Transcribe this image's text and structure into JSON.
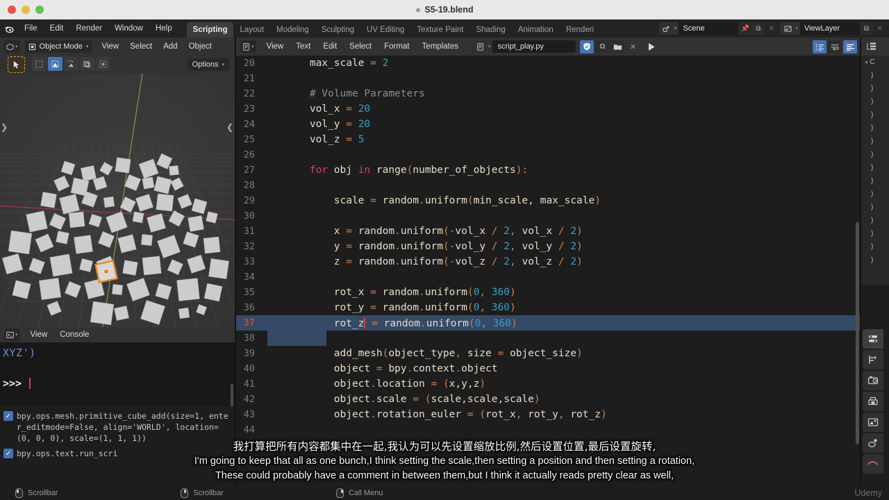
{
  "window": {
    "title": "S5-19.blend",
    "traffic_lights": [
      "close",
      "minimize",
      "maximize"
    ]
  },
  "topbar": {
    "logo_icon": "blender-logo-icon",
    "menus": [
      "File",
      "Edit",
      "Render",
      "Window",
      "Help"
    ],
    "workspace_tabs": [
      {
        "label": "Scripting",
        "active": true
      },
      {
        "label": "Layout",
        "active": false
      },
      {
        "label": "Modeling",
        "active": false
      },
      {
        "label": "Sculpting",
        "active": false
      },
      {
        "label": "UV Editing",
        "active": false
      },
      {
        "label": "Texture Paint",
        "active": false
      },
      {
        "label": "Shading",
        "active": false
      },
      {
        "label": "Animation",
        "active": false
      },
      {
        "label": "Renderi",
        "active": false
      }
    ],
    "scene": {
      "icon": "scene-icon",
      "name": "Scene",
      "pin_icon": "pin-icon",
      "copy_icon": "duplicate-icon",
      "close_icon": "x-icon"
    },
    "viewlayer": {
      "icon": "viewlayer-icon",
      "name": "ViewLayer",
      "copy_icon": "duplicate-icon",
      "close_icon": "x-icon"
    }
  },
  "viewport": {
    "editor_type_icon": "editor-type-3dview-icon",
    "mode": "Object Mode",
    "mode_icon": "object-mode-icon",
    "menus": [
      "View",
      "Select",
      "Add",
      "Object"
    ],
    "tool_icon": "tweak-cursor-icon",
    "select_modes": [
      "select-box-icon",
      "select-circle-icon",
      "select-lasso-icon",
      "select-extend-icon",
      "select-invert-icon"
    ],
    "options_label": "Options",
    "gizmo_axes": [
      "X",
      "Y",
      "Z"
    ],
    "object_count_visible": 110,
    "arrow_left_icon": "chevron-left-icon",
    "arrow_right_icon": "chevron-left-icon"
  },
  "console": {
    "editor_type_icon": "editor-type-console-icon",
    "menus": [
      "View",
      "Console"
    ],
    "last_output": "XYZ')",
    "prompt": ">>>",
    "input_value": ""
  },
  "info_log": {
    "rows": [
      {
        "checked": true,
        "text": "bpy.ops.mesh.primitive_cube_add(size=1, enter_editmode=False, align='WORLD', location=(0, 0, 0), scale=(1, 1, 1))"
      },
      {
        "checked": true,
        "text": "bpy.ops.text.run_scri"
      }
    ]
  },
  "editor": {
    "editor_type_icon": "editor-type-text-icon",
    "menus": [
      "View",
      "Text",
      "Edit",
      "Select",
      "Format",
      "Templates"
    ],
    "datablock_icon": "text-datablock-icon",
    "filename": "script_play.py",
    "buttons": [
      {
        "name": "register-toggle",
        "icon": "shield-check-icon",
        "on": true
      },
      {
        "name": "new-text-button",
        "icon": "duplicate-icon",
        "on": false
      },
      {
        "name": "open-text-button",
        "icon": "folder-icon",
        "on": false
      },
      {
        "name": "unlink-text-button",
        "icon": "x-icon",
        "on": false
      },
      {
        "name": "run-script-button",
        "icon": "play-icon",
        "on": false
      }
    ],
    "toggles": [
      {
        "name": "line-numbers-toggle",
        "icon": "line-numbers-icon",
        "on": true
      },
      {
        "name": "word-wrap-toggle",
        "icon": "word-wrap-icon",
        "on": false
      },
      {
        "name": "syntax-highlight-toggle",
        "icon": "syntax-highlight-icon",
        "on": true
      }
    ],
    "cursor_line": 37,
    "selection_lines": [
      37,
      38
    ],
    "code": [
      {
        "n": 20,
        "tokens": [
          {
            "t": "        ",
            "c": "plain"
          },
          {
            "t": "max_scale ",
            "c": "plain"
          },
          {
            "t": "= ",
            "c": "op"
          },
          {
            "t": "2",
            "c": "num"
          }
        ]
      },
      {
        "n": 21,
        "tokens": []
      },
      {
        "n": 22,
        "tokens": [
          {
            "t": "        ",
            "c": "plain"
          },
          {
            "t": "# Volume Parameters",
            "c": "com"
          }
        ]
      },
      {
        "n": 23,
        "tokens": [
          {
            "t": "        ",
            "c": "plain"
          },
          {
            "t": "vol_x ",
            "c": "plain"
          },
          {
            "t": "= ",
            "c": "op"
          },
          {
            "t": "20",
            "c": "num"
          }
        ]
      },
      {
        "n": 24,
        "tokens": [
          {
            "t": "        ",
            "c": "plain"
          },
          {
            "t": "vol_y ",
            "c": "plain"
          },
          {
            "t": "= ",
            "c": "op"
          },
          {
            "t": "20",
            "c": "num"
          }
        ]
      },
      {
        "n": 25,
        "tokens": [
          {
            "t": "        ",
            "c": "plain"
          },
          {
            "t": "vol_z ",
            "c": "plain"
          },
          {
            "t": "= ",
            "c": "op"
          },
          {
            "t": "5",
            "c": "num"
          }
        ]
      },
      {
        "n": 26,
        "tokens": []
      },
      {
        "n": 27,
        "tokens": [
          {
            "t": "        ",
            "c": "plain"
          },
          {
            "t": "for",
            "c": "kw"
          },
          {
            "t": " obj ",
            "c": "plain"
          },
          {
            "t": "in",
            "c": "kw"
          },
          {
            "t": " range",
            "c": "plain"
          },
          {
            "t": "(",
            "c": "op"
          },
          {
            "t": "number_of_objects",
            "c": "plain"
          },
          {
            "t": "):",
            "c": "op"
          }
        ]
      },
      {
        "n": 28,
        "tokens": []
      },
      {
        "n": 29,
        "tokens": [
          {
            "t": "            ",
            "c": "plain"
          },
          {
            "t": "scale ",
            "c": "plain"
          },
          {
            "t": "= ",
            "c": "op"
          },
          {
            "t": "random",
            "c": "plain"
          },
          {
            "t": ".",
            "c": "op"
          },
          {
            "t": "uniform",
            "c": "plain"
          },
          {
            "t": "(",
            "c": "op"
          },
          {
            "t": "min_scale, max_scale",
            "c": "plain"
          },
          {
            "t": ")",
            "c": "op"
          }
        ]
      },
      {
        "n": 30,
        "tokens": []
      },
      {
        "n": 31,
        "tokens": [
          {
            "t": "            ",
            "c": "plain"
          },
          {
            "t": "x ",
            "c": "plain"
          },
          {
            "t": "= ",
            "c": "op"
          },
          {
            "t": "random",
            "c": "plain"
          },
          {
            "t": ".",
            "c": "op"
          },
          {
            "t": "uniform",
            "c": "plain"
          },
          {
            "t": "(-",
            "c": "op"
          },
          {
            "t": "vol_x ",
            "c": "plain"
          },
          {
            "t": "/ ",
            "c": "op"
          },
          {
            "t": "2",
            "c": "num"
          },
          {
            "t": ", ",
            "c": "op"
          },
          {
            "t": "vol_x ",
            "c": "plain"
          },
          {
            "t": "/ ",
            "c": "op"
          },
          {
            "t": "2",
            "c": "num"
          },
          {
            "t": ")",
            "c": "op"
          }
        ]
      },
      {
        "n": 32,
        "tokens": [
          {
            "t": "            ",
            "c": "plain"
          },
          {
            "t": "y ",
            "c": "plain"
          },
          {
            "t": "= ",
            "c": "op"
          },
          {
            "t": "random",
            "c": "plain"
          },
          {
            "t": ".",
            "c": "op"
          },
          {
            "t": "uniform",
            "c": "plain"
          },
          {
            "t": "(-",
            "c": "op"
          },
          {
            "t": "vol_y ",
            "c": "plain"
          },
          {
            "t": "/ ",
            "c": "op"
          },
          {
            "t": "2",
            "c": "num"
          },
          {
            "t": ", ",
            "c": "op"
          },
          {
            "t": "vol_y ",
            "c": "plain"
          },
          {
            "t": "/ ",
            "c": "op"
          },
          {
            "t": "2",
            "c": "num"
          },
          {
            "t": ")",
            "c": "op"
          }
        ]
      },
      {
        "n": 33,
        "tokens": [
          {
            "t": "            ",
            "c": "plain"
          },
          {
            "t": "z ",
            "c": "plain"
          },
          {
            "t": "= ",
            "c": "op"
          },
          {
            "t": "random",
            "c": "plain"
          },
          {
            "t": ".",
            "c": "op"
          },
          {
            "t": "uniform",
            "c": "plain"
          },
          {
            "t": "(-",
            "c": "op"
          },
          {
            "t": "vol_z ",
            "c": "plain"
          },
          {
            "t": "/ ",
            "c": "op"
          },
          {
            "t": "2",
            "c": "num"
          },
          {
            "t": ", ",
            "c": "op"
          },
          {
            "t": "vol_z ",
            "c": "plain"
          },
          {
            "t": "/ ",
            "c": "op"
          },
          {
            "t": "2",
            "c": "num"
          },
          {
            "t": ")",
            "c": "op"
          }
        ]
      },
      {
        "n": 34,
        "tokens": []
      },
      {
        "n": 35,
        "tokens": [
          {
            "t": "            ",
            "c": "plain"
          },
          {
            "t": "rot_x ",
            "c": "plain"
          },
          {
            "t": "= ",
            "c": "op"
          },
          {
            "t": "random",
            "c": "plain"
          },
          {
            "t": ".",
            "c": "op"
          },
          {
            "t": "uniform",
            "c": "plain"
          },
          {
            "t": "(",
            "c": "op"
          },
          {
            "t": "0",
            "c": "num"
          },
          {
            "t": ", ",
            "c": "op"
          },
          {
            "t": "360",
            "c": "num"
          },
          {
            "t": ")",
            "c": "op"
          }
        ]
      },
      {
        "n": 36,
        "tokens": [
          {
            "t": "            ",
            "c": "plain"
          },
          {
            "t": "rot_y ",
            "c": "plain"
          },
          {
            "t": "= ",
            "c": "op"
          },
          {
            "t": "random",
            "c": "plain"
          },
          {
            "t": ".",
            "c": "op"
          },
          {
            "t": "uniform",
            "c": "plain"
          },
          {
            "t": "(",
            "c": "op"
          },
          {
            "t": "0",
            "c": "num"
          },
          {
            "t": ", ",
            "c": "op"
          },
          {
            "t": "360",
            "c": "num"
          },
          {
            "t": ")",
            "c": "op"
          }
        ]
      },
      {
        "n": 37,
        "tokens": [
          {
            "t": "            ",
            "c": "plain"
          },
          {
            "t": "rot_z",
            "c": "plain"
          },
          {
            "t": "CARET",
            "c": "caret"
          },
          {
            "t": " = ",
            "c": "op"
          },
          {
            "t": "random",
            "c": "plain"
          },
          {
            "t": ".",
            "c": "op"
          },
          {
            "t": "uniform",
            "c": "plain"
          },
          {
            "t": "(",
            "c": "op"
          },
          {
            "t": "0",
            "c": "num"
          },
          {
            "t": ", ",
            "c": "op"
          },
          {
            "t": "360",
            "c": "num"
          },
          {
            "t": ")",
            "c": "op"
          }
        ]
      },
      {
        "n": 38,
        "tokens": []
      },
      {
        "n": 39,
        "tokens": [
          {
            "t": "            ",
            "c": "plain"
          },
          {
            "t": "add_mesh",
            "c": "plain"
          },
          {
            "t": "(",
            "c": "op"
          },
          {
            "t": "object_type",
            "c": "plain"
          },
          {
            "t": ", ",
            "c": "op"
          },
          {
            "t": "size ",
            "c": "plain"
          },
          {
            "t": "= ",
            "c": "op"
          },
          {
            "t": "object_size",
            "c": "plain"
          },
          {
            "t": ")",
            "c": "op"
          }
        ]
      },
      {
        "n": 40,
        "tokens": [
          {
            "t": "            ",
            "c": "plain"
          },
          {
            "t": "object ",
            "c": "plain"
          },
          {
            "t": "= ",
            "c": "op"
          },
          {
            "t": "bpy",
            "c": "plain"
          },
          {
            "t": ".",
            "c": "op"
          },
          {
            "t": "context",
            "c": "plain"
          },
          {
            "t": ".",
            "c": "op"
          },
          {
            "t": "object",
            "c": "plain"
          }
        ]
      },
      {
        "n": 41,
        "tokens": [
          {
            "t": "            ",
            "c": "plain"
          },
          {
            "t": "object",
            "c": "plain"
          },
          {
            "t": ".",
            "c": "op"
          },
          {
            "t": "location ",
            "c": "plain"
          },
          {
            "t": "= ",
            "c": "op"
          },
          {
            "t": "(",
            "c": "op"
          },
          {
            "t": "x,y,z",
            "c": "plain"
          },
          {
            "t": ")",
            "c": "op"
          }
        ]
      },
      {
        "n": 42,
        "tokens": [
          {
            "t": "            ",
            "c": "plain"
          },
          {
            "t": "object",
            "c": "plain"
          },
          {
            "t": ".",
            "c": "op"
          },
          {
            "t": "scale ",
            "c": "plain"
          },
          {
            "t": "= ",
            "c": "op"
          },
          {
            "t": "(",
            "c": "op"
          },
          {
            "t": "scale,scale,scale",
            "c": "plain"
          },
          {
            "t": ")",
            "c": "op"
          }
        ]
      },
      {
        "n": 43,
        "tokens": [
          {
            "t": "            ",
            "c": "plain"
          },
          {
            "t": "object",
            "c": "plain"
          },
          {
            "t": ".",
            "c": "op"
          },
          {
            "t": "rotation_euler ",
            "c": "plain"
          },
          {
            "t": "= ",
            "c": "op"
          },
          {
            "t": "(",
            "c": "op"
          },
          {
            "t": "rot_x",
            "c": "plain"
          },
          {
            "t": ", ",
            "c": "op"
          },
          {
            "t": "rot_y",
            "c": "plain"
          },
          {
            "t": ", ",
            "c": "op"
          },
          {
            "t": "rot_z",
            "c": "plain"
          },
          {
            "t": ")",
            "c": "op"
          }
        ]
      },
      {
        "n": 44,
        "tokens": []
      }
    ]
  },
  "outliner": {
    "editor_type_icon": "editor-type-outliner-icon",
    "collection_label": "C",
    "rows": [
      ")",
      ")",
      ")",
      ")",
      ")",
      ")",
      ")",
      ")",
      ")",
      ")",
      ")",
      ")",
      ")",
      ")",
      ")"
    ]
  },
  "properties": {
    "tabs": [
      {
        "name": "tool-tab",
        "icon": "sliders-icon",
        "active": true
      },
      {
        "name": "render-tab",
        "icon": "render-camera-back-icon",
        "active": false
      },
      {
        "name": "output-tab",
        "icon": "printer-icon",
        "active": false
      },
      {
        "name": "viewlayer-tab",
        "icon": "images-icon",
        "active": false
      },
      {
        "name": "scene-tab",
        "icon": "scene-icon",
        "active": false
      },
      {
        "name": "world-tab",
        "icon": "world-icon",
        "active": false
      }
    ]
  },
  "statusbar": {
    "items": [
      {
        "icon": "mouse-left-icon",
        "label": "Scrollbar"
      },
      {
        "icon": "mouse-middle-icon",
        "label": "Scrollbar"
      },
      {
        "icon": "mouse-right-icon",
        "label": "Call Menu"
      }
    ],
    "watermark": "Udemy"
  },
  "subtitles": {
    "zh": "我打算把所有内容都集中在一起,我认为可以先设置缩放比例,然后设置位置,最后设置旋转,",
    "en_line1": "I'm going to keep that all as one bunch,I think setting the scale,then setting a position and then setting a rotation,",
    "en_line2": "These could probably have a comment in between them,but I think it actually reads pretty clear as well,"
  },
  "colors": {
    "accent_blue": "#4772b3",
    "selection_blue": "#354a66",
    "keyword_pink": "#de3c6e",
    "number_blue": "#3b9ec9",
    "operator_orange": "#d08050",
    "comment_gray": "#8d8d8d",
    "cursor_red": "#d5453a",
    "active_orange": "#e0a030",
    "panel_bg": "#323232",
    "editor_bg": "#1d1d1d"
  }
}
